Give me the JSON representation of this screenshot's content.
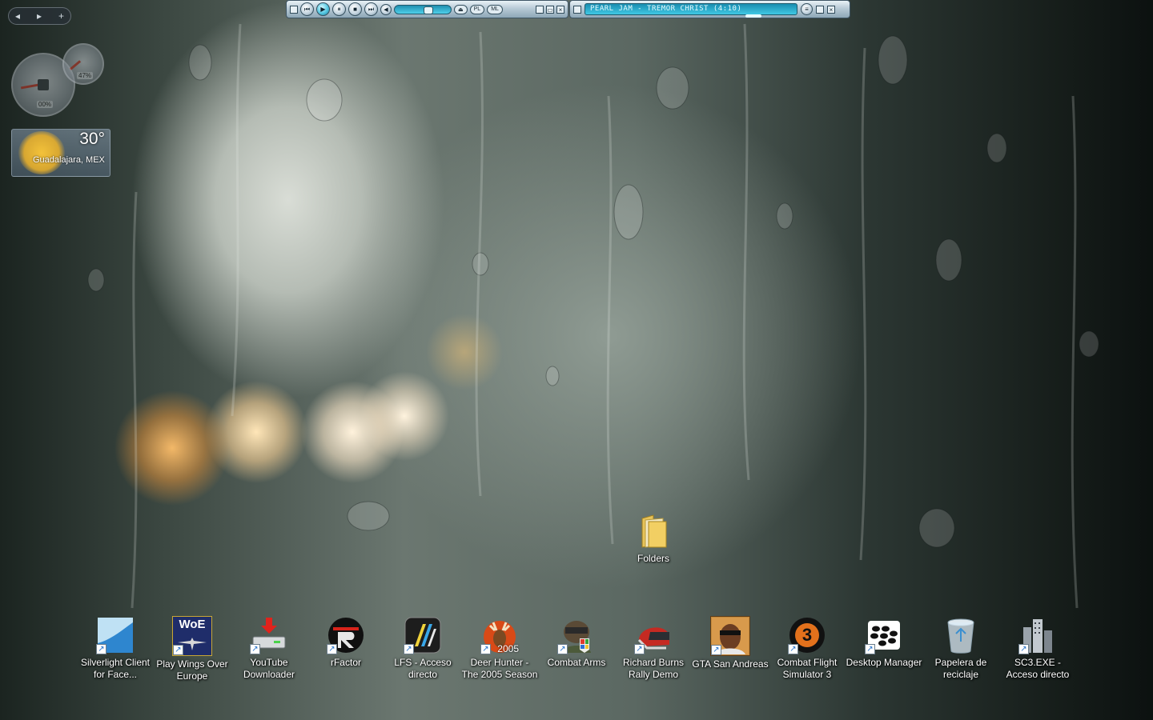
{
  "nav": {
    "back": "◂",
    "forward": "▸",
    "add": "+"
  },
  "gauges": {
    "cpu_readout": "00%",
    "mem_readout": "47%"
  },
  "weather": {
    "temperature": "30°",
    "location": "Guadalajara, MEX"
  },
  "player": {
    "controls": {
      "prev": "⏮",
      "play": "▶",
      "pause": "⏸",
      "stop": "■",
      "next": "⏭"
    },
    "eq_label": "EQ",
    "pl_label": "PL",
    "ml_label": "ML",
    "now_playing": "PEARL JAM - TREMOR CHRIST (4:10)"
  },
  "desktop": {
    "icons": [
      {
        "label": "Folders"
      },
      {
        "label": "Silverlight Client for Face..."
      },
      {
        "label": "Play Wings Over Europe"
      },
      {
        "label": "YouTube Downloader"
      },
      {
        "label": "rFactor"
      },
      {
        "label": "LFS - Acceso directo"
      },
      {
        "label": "Deer Hunter - The 2005 Season"
      },
      {
        "label": "Combat Arms"
      },
      {
        "label": "Richard Burns Rally Demo"
      },
      {
        "label": "GTA San Andreas"
      },
      {
        "label": "Combat Flight Simulator 3"
      },
      {
        "label": "Desktop Manager"
      },
      {
        "label": "Papelera de reciclaje"
      },
      {
        "label": "SC3.EXE - Acceso directo"
      }
    ],
    "woe_badge": "WoE",
    "deer_year": "2005",
    "cfs_number": "3"
  },
  "colors": {
    "accent": "#40c8e4",
    "frame": "#3e5565"
  }
}
